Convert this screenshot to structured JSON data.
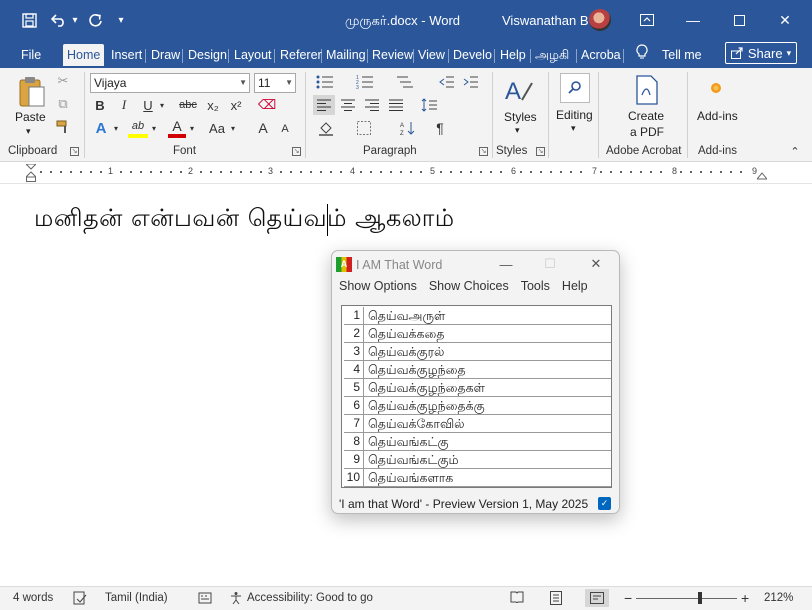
{
  "window": {
    "doc_title": "முருகர்.docx  -  Word",
    "user_name": "Viswanathan B",
    "controls": {
      "minimize": "—",
      "restore": "⧉",
      "close": "✕",
      "ribbon_display": "⊡"
    }
  },
  "qat": {
    "save": "💾",
    "undo": "↶",
    "undo_dd": "▾",
    "redo": "↻",
    "customize": "▾"
  },
  "tabs": [
    "File",
    "Home",
    "Insert",
    "Draw",
    "Design",
    "Layout",
    "Referer",
    "Mailing",
    "Review",
    "View",
    "Develo",
    "Help",
    "அழகி",
    "Acroba"
  ],
  "tell_me": "Tell me",
  "share": "Share",
  "ribbon": {
    "clipboard": {
      "label": "Clipboard",
      "paste": "Paste"
    },
    "font": {
      "label": "Font",
      "font_name": "Vijaya",
      "font_size": "11",
      "bold": "B",
      "italic": "I",
      "underline": "U",
      "strike": "abc",
      "subscript": "x₂",
      "superscript": "x²",
      "text_effects": "A",
      "highlight": "ab",
      "font_color": "A",
      "change_case": "Aa",
      "grow": "A",
      "shrink": "A"
    },
    "paragraph": {
      "label": "Paragraph",
      "pilcrow": "¶"
    },
    "styles": {
      "label": "Styles",
      "button": "Styles"
    },
    "editing": {
      "button": "Editing"
    },
    "acrobat": {
      "label": "Adobe Acrobat",
      "button_line1": "Create",
      "button_line2": "a PDF"
    },
    "addins": {
      "label": "Add-ins",
      "button": "Add-ins"
    }
  },
  "ruler": {
    "numbers": [
      "1",
      "1",
      "2",
      "3",
      "4",
      "5",
      "6",
      "7",
      "8",
      "9"
    ]
  },
  "document": {
    "text": "மனிதன் என்பவன் தெய்வம் ஆகலாம்"
  },
  "popup": {
    "title": "I AM That Word",
    "icon": "A",
    "controls": {
      "minimize": "—",
      "maximize": "☐",
      "close": "✕"
    },
    "menu": [
      "Show Options",
      "Show Choices",
      "Tools",
      "Help"
    ],
    "items": [
      {
        "num": "1",
        "word": "தெய்வஅருள்"
      },
      {
        "num": "2",
        "word": "தெய்வக்கதை"
      },
      {
        "num": "3",
        "word": "தெய்வக்குரல்"
      },
      {
        "num": "4",
        "word": "தெய்வக்குழந்தை"
      },
      {
        "num": "5",
        "word": "தெய்வக்குழந்தைகள்"
      },
      {
        "num": "6",
        "word": "தெய்வக்குழந்தைக்கு"
      },
      {
        "num": "7",
        "word": "தெய்வக்கோவில்"
      },
      {
        "num": "8",
        "word": "தெய்வங்கட்கு"
      },
      {
        "num": "9",
        "word": "தெய்வங்கட்கும்"
      },
      {
        "num": "10",
        "word": "தெய்வங்களாக"
      }
    ],
    "status": "'I am that Word' - Preview Version 1, May 2025",
    "checked": true
  },
  "statusbar": {
    "words": "4 words",
    "language": "Tamil (India)",
    "accessibility": "Accessibility: Good to go",
    "zoom_percent": "212%",
    "zoom_minus": "−",
    "zoom_plus": "+",
    "zoom_level": 212
  },
  "colors": {
    "accent": "#2b579a",
    "ribbon": "#f3f3f3",
    "check": "#0067c0"
  }
}
